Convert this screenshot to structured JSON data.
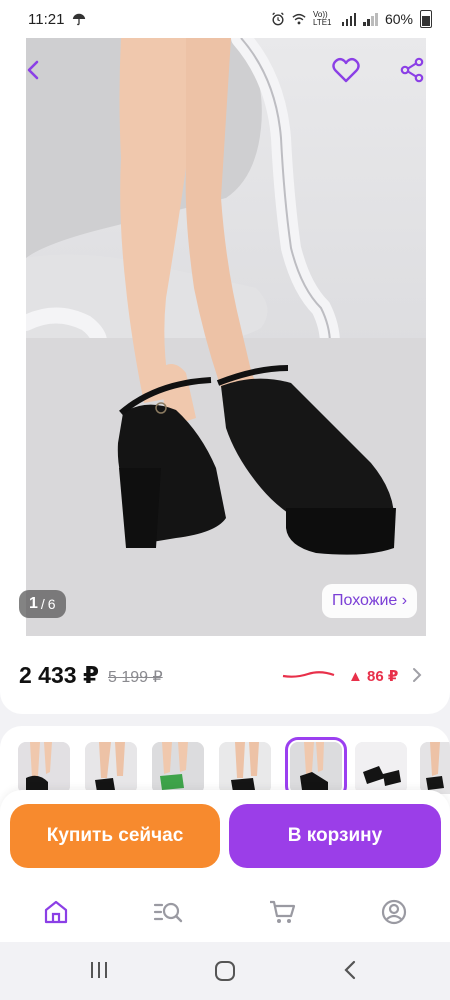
{
  "status_bar": {
    "time": "11:21",
    "network": "Vo)) LTE1",
    "battery": "60%"
  },
  "product_image": {
    "current": "1",
    "separator": "/",
    "total": "6",
    "similar_label": "Похожие ›"
  },
  "price": {
    "current": "2 433 ₽",
    "old": "5 199 ₽",
    "change": "▲ 86 ₽"
  },
  "thumbnails": {
    "count": 8,
    "selected_index": 4
  },
  "actions": {
    "buy_now": "Купить сейчас",
    "add_to_cart": "В корзину"
  },
  "icons": {
    "back": "chevron-left-icon",
    "favorite": "heart-icon",
    "share": "share-icon",
    "home": "home-icon",
    "catalog": "search-list-icon",
    "cart": "cart-icon",
    "profile": "profile-icon"
  },
  "colors": {
    "accent": "#9b3ee8",
    "buy": "#f78a2e",
    "price_up": "#e8304a"
  }
}
